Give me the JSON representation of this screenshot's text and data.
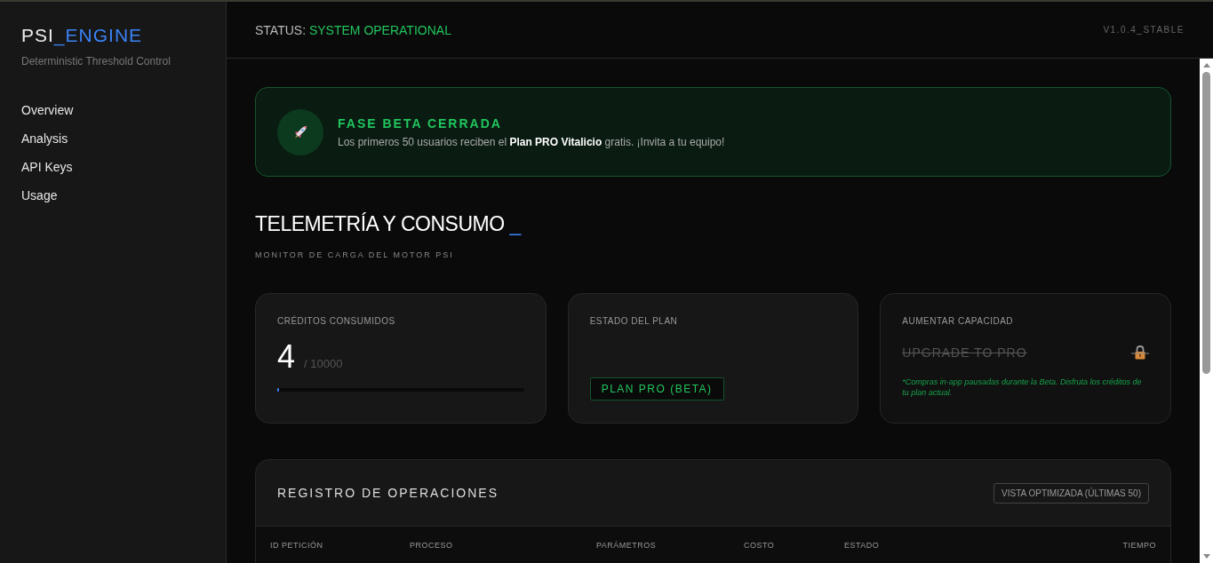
{
  "sidebar": {
    "logo": {
      "prefix": "PSI",
      "accent": "_ENGINE"
    },
    "subtitle": "Deterministic Threshold Control",
    "items": [
      {
        "label": "Overview",
        "selected": false
      },
      {
        "label": "Analysis",
        "selected": false
      },
      {
        "label": "API Keys",
        "selected": false
      },
      {
        "label": "Usage",
        "selected": false
      }
    ]
  },
  "topbar": {
    "status_label": "STATUS:",
    "status_value": "SYSTEM OPERATIONAL",
    "version": "V1.0.4_STABLE"
  },
  "banner": {
    "title": "FASE BETA CERRADA",
    "text": "Los primeros 50 usuarios reciben el **Plan PRO Vitalicio** gratis. ¡Invita a tu equipo!"
  },
  "section": {
    "title": "TELEMETRÍA Y CONSUMO",
    "cursor": "_",
    "subtitle": "MONITOR DE CARGA DEL MOTOR PSI"
  },
  "cards": [
    {
      "kind": "credits",
      "label": "CRÉDITOS CONSUMIDOS",
      "value": "4",
      "total": "/ 10000",
      "level": 0.0004
    },
    {
      "kind": "plan",
      "label": "ESTADO DEL PLAN",
      "badge": "PLAN PRO (BETA)"
    },
    {
      "kind": "upgrade",
      "label": "AUMENTAR CAPACIDAD",
      "action": "UPGRADE TO PRO",
      "disabled": true,
      "note": "*Compras in-app pausadas durante la Beta. Disfruta los créditos de tu plan actual."
    }
  ],
  "log": {
    "title": "REGISTRO DE OPERACIONES",
    "button": "VISTA OPTIMIZADA (ÚLTIMAS 50)",
    "columns": [
      "ID PETICIÓN",
      "PROCESO",
      "PARÁMETROS",
      "COSTO",
      "ESTADO",
      "TIEMPO"
    ]
  }
}
